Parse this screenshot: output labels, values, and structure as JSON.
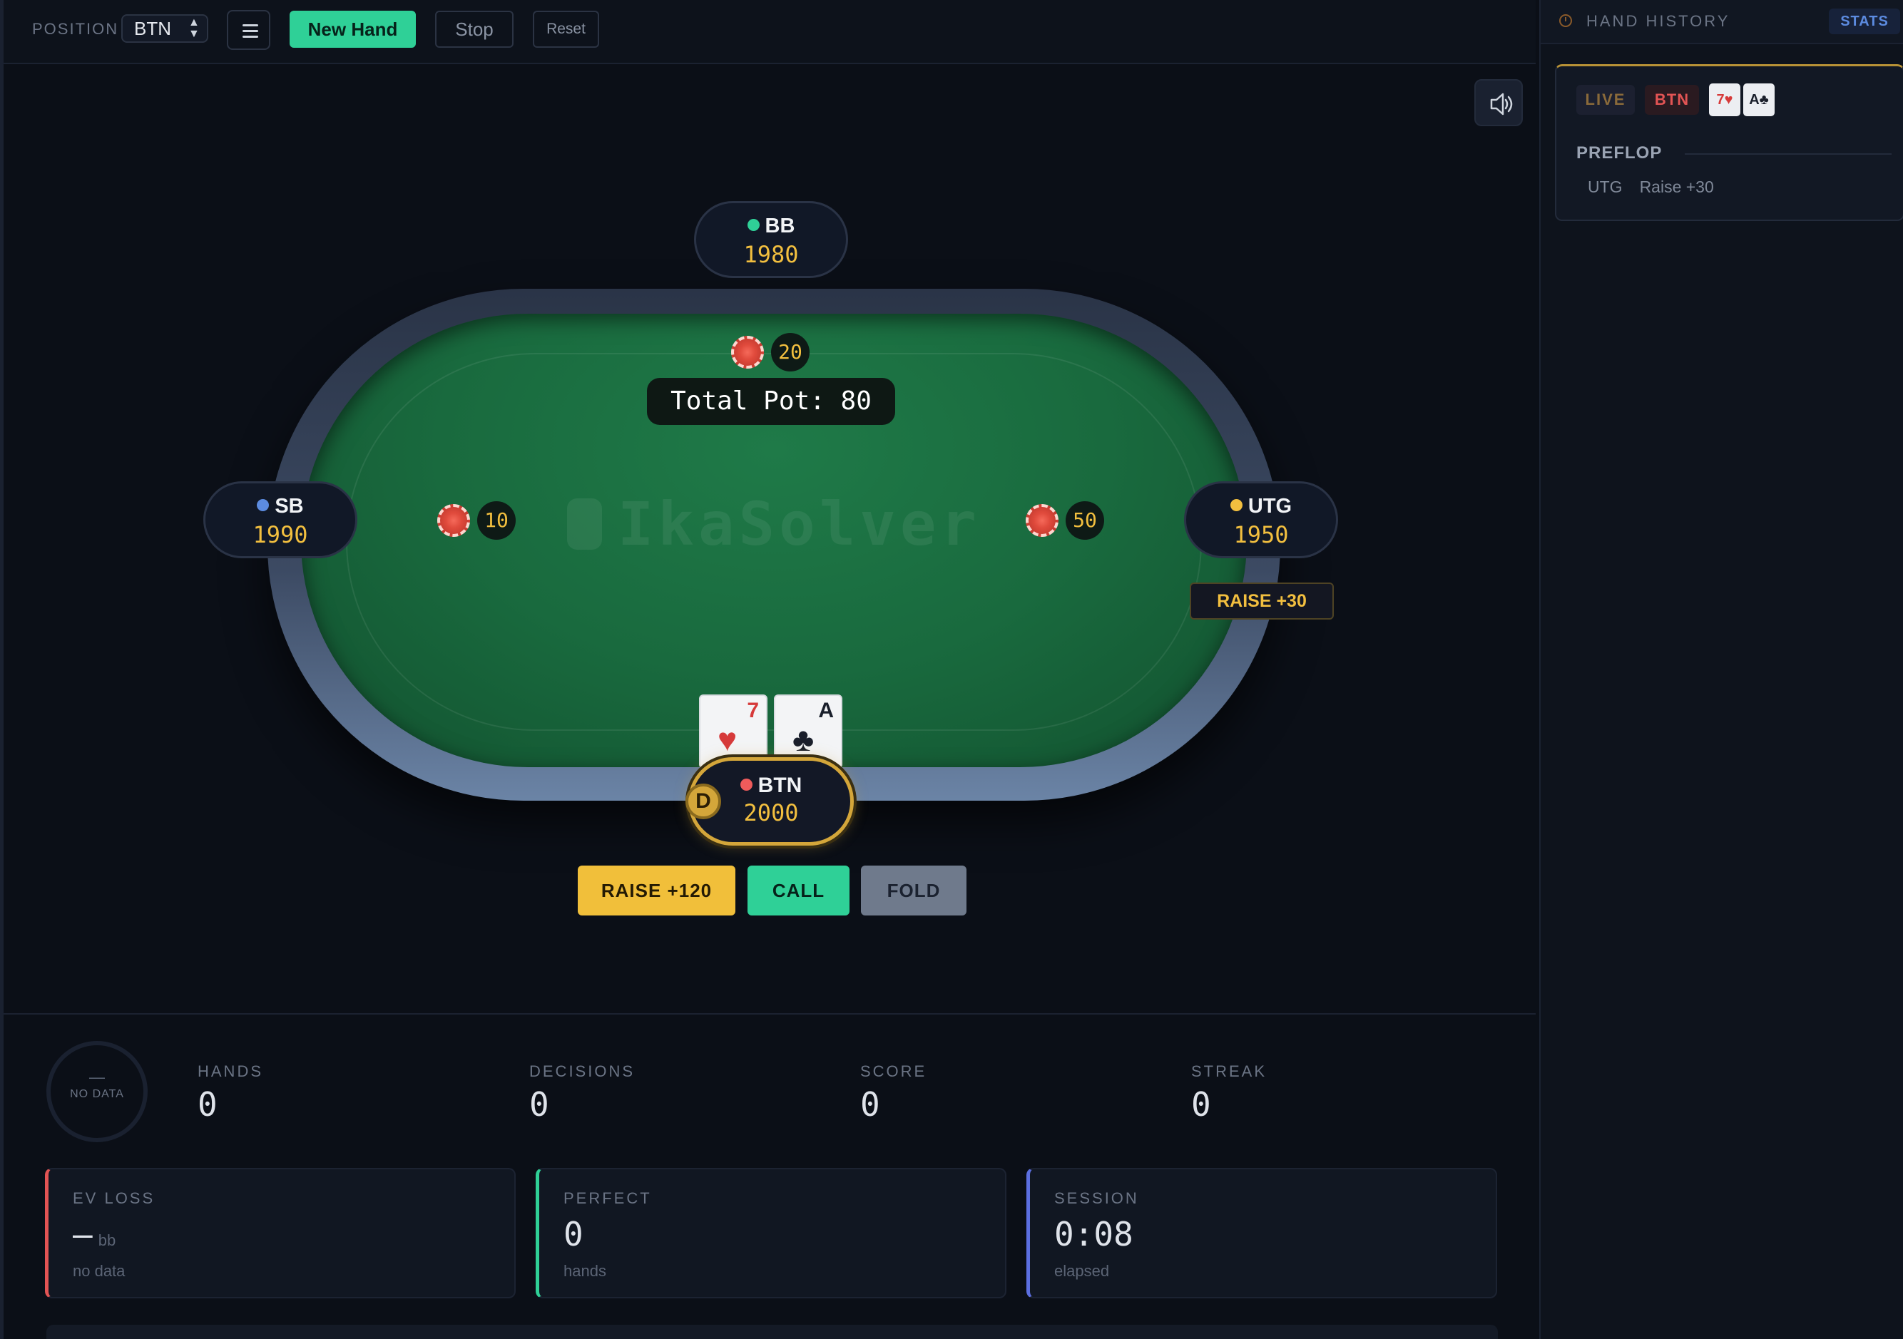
{
  "topbar": {
    "position_label": "POSITION",
    "position_value": "BTN",
    "new_hand": "New Hand",
    "stop": "Stop",
    "reset": "Reset"
  },
  "table": {
    "pot_label": "Total Pot: 80",
    "center_bet": "20",
    "watermark": "IkaSolver",
    "seats": {
      "bb": {
        "name": "BB",
        "stack": "1980",
        "dot_color": "#2fd097"
      },
      "sb": {
        "name": "SB",
        "stack": "1990",
        "bet": "10",
        "dot_color": "#5c8be0"
      },
      "utg": {
        "name": "UTG",
        "stack": "1950",
        "bet": "50",
        "dot_color": "#f2bf3f",
        "last_action": "RAISE +30"
      },
      "btn": {
        "name": "BTN",
        "stack": "2000",
        "dot_color": "#ef5b5b",
        "dealer": "D"
      }
    },
    "hero_cards": [
      {
        "rank": "7",
        "suit": "♥",
        "color": "#d63a3a"
      },
      {
        "rank": "A",
        "suit": "♣",
        "color": "#1a1f2b"
      }
    ]
  },
  "actions": {
    "raise": "RAISE +120",
    "call": "CALL",
    "fold": "FOLD"
  },
  "stats": {
    "ring_dash": "—",
    "ring_label": "NO DATA",
    "hands": {
      "label": "HANDS",
      "value": "0"
    },
    "decisions": {
      "label": "DECISIONS",
      "value": "0"
    },
    "score": {
      "label": "SCORE",
      "value": "0"
    },
    "streak": {
      "label": "STREAK",
      "value": "0"
    },
    "ev_loss": {
      "label": "EV LOSS",
      "value": "—",
      "unit": "bb",
      "sub": "no data",
      "color": "#e35454"
    },
    "perfect": {
      "label": "PERFECT",
      "value": "0",
      "sub": "hands",
      "color": "#2fd097"
    },
    "session": {
      "label": "SESSION",
      "value": "0:08",
      "sub": "elapsed",
      "color": "#5c6fe0"
    }
  },
  "sidebar": {
    "title": "HAND HISTORY",
    "stats_tab": "STATS",
    "entry": {
      "status": "LIVE",
      "position": "BTN",
      "cards": [
        {
          "text": "7♥",
          "color": "#d63a3a"
        },
        {
          "text": "A♣",
          "color": "#1a1f2b"
        }
      ],
      "street": "PREFLOP",
      "action_player": "UTG",
      "action_text": "Raise +30"
    }
  }
}
